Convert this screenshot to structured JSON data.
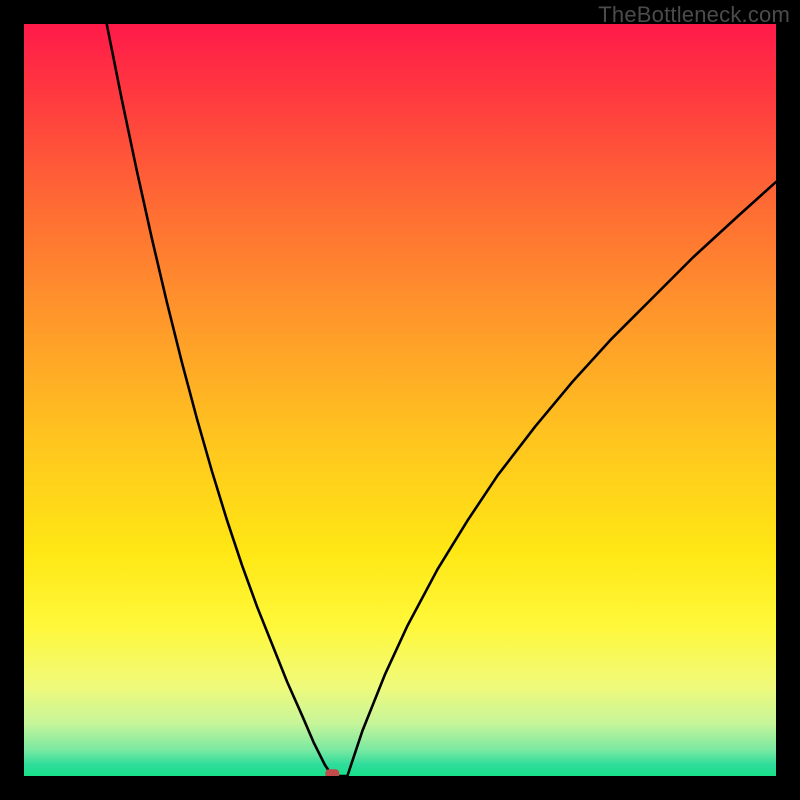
{
  "watermark": "TheBottleneck.com",
  "chart_data": {
    "type": "line",
    "title": "",
    "xlabel": "",
    "ylabel": "",
    "xlim": [
      0,
      100
    ],
    "ylim": [
      0,
      100
    ],
    "grid": false,
    "legend": false,
    "notes": "Gradient background from red (top) through orange/yellow to green (bottom). Two black curves descending from upper-left and upper-right meeting near a small red marker at the bottom (approx x=41, y=0). No axis ticks or numeric labels are visible.",
    "series": [
      {
        "name": "left-curve",
        "x": [
          11,
          13,
          15,
          17,
          19,
          21,
          23,
          25,
          27,
          29,
          31,
          33,
          35,
          37,
          38.5,
          40,
          41
        ],
        "y": [
          100,
          90,
          80.5,
          71.5,
          63,
          55,
          47.5,
          40.5,
          34,
          28,
          22.5,
          17.5,
          12.5,
          8,
          4.5,
          1.5,
          0
        ]
      },
      {
        "name": "right-curve",
        "x": [
          43,
          45,
          48,
          51,
          55,
          59,
          63,
          68,
          73,
          78,
          83,
          89,
          95,
          100
        ],
        "y": [
          0,
          6,
          13.5,
          20,
          27.5,
          34,
          40,
          46.5,
          52.5,
          58,
          63,
          69,
          74.5,
          79
        ]
      }
    ],
    "marker": {
      "x": 41,
      "y": 0.3,
      "color": "#c24a4a"
    }
  },
  "gradient_stops": [
    {
      "offset": 0,
      "color": "#ff1a49"
    },
    {
      "offset": 0.1,
      "color": "#ff3b3f"
    },
    {
      "offset": 0.25,
      "color": "#ff6e33"
    },
    {
      "offset": 0.4,
      "color": "#ff9a2a"
    },
    {
      "offset": 0.55,
      "color": "#ffc41f"
    },
    {
      "offset": 0.7,
      "color": "#ffe714"
    },
    {
      "offset": 0.8,
      "color": "#fff83a"
    },
    {
      "offset": 0.88,
      "color": "#f0fa7a"
    },
    {
      "offset": 0.93,
      "color": "#c7f59a"
    },
    {
      "offset": 0.965,
      "color": "#7ae9a1"
    },
    {
      "offset": 0.985,
      "color": "#2fdc9b"
    },
    {
      "offset": 1.0,
      "color": "#17e08a"
    }
  ]
}
